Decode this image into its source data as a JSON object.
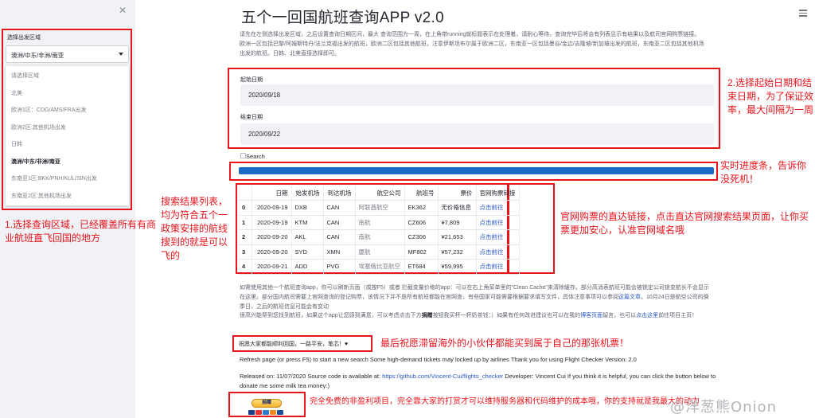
{
  "sidebar": {
    "close_icon": "close-icon",
    "select_label": "选择出发区域",
    "selected_value": "澳洲/中东/非洲/南亚",
    "options": [
      "请选择区域",
      "北美",
      "欧洲1区：CDG/AMS/FRA出发",
      "欧洲2区:其他机场出发",
      "日韩",
      "澳洲/中东/非洲/南亚",
      "东南亚1区:BKK/PNH/KUL/SIN出发",
      "东南亚2区:其他机场出发"
    ],
    "selected_index": 5
  },
  "main": {
    "title": "五个一回国航班查询APP v2.0",
    "intro": "请先在左侧选择出发区域，之后设置查询日期区间，最大 查询范围为一周，在上角带running就标题表示在处理着，请耐心等待。查询完毕后将会有列表显示有结果以及航司官网购票链接。欧洲一区包括巴黎/阿姆斯特丹/法兰克福出发的航班，欧洲二区包括其他航班，注意伊斯坦布尔属于欧洲二区，东南亚一区包括曼谷/金边/吉隆坡/新加坡出发的航班，东南亚二区包括其他机场出发的航班。日韩、北美直接选择即可。",
    "start_label": "起始日期",
    "start_date": "2020/09/18",
    "end_label": "结束日期",
    "end_date": "2020/09/22",
    "search_label": "Search",
    "progress": 1.0
  },
  "table": {
    "headers": [
      "",
      "日期",
      "始发机场",
      "到达机场",
      "航空公司",
      "航班号",
      "票价",
      "官网购票链接"
    ],
    "rows": [
      [
        "0",
        "2020-09-19",
        "DXB",
        "CAN",
        "阿联酋航空",
        "EK362",
        "无价格信息",
        "点击前往"
      ],
      [
        "1",
        "2020-09-19",
        "KTM",
        "CAN",
        "南航",
        "CZ606",
        "¥7,809",
        "点击前往"
      ],
      [
        "2",
        "2020-09-20",
        "AKL",
        "CAN",
        "南航",
        "CZ306",
        "¥21,653",
        "点击前往"
      ],
      [
        "3",
        "2020-09-20",
        "SYD",
        "XMN",
        "厦航",
        "MF802",
        "¥57,232",
        "点击前往"
      ],
      [
        "4",
        "2020-09-21",
        "ADD",
        "PVG",
        "埃塞俄比亚航空",
        "ET684",
        "¥59,995",
        "点击前往"
      ]
    ]
  },
  "body": {
    "p1a": "如需使用其他一个航班查询app，你可以刷新页面（或按F5）或者 拦截变量价格的app：可以在右上角菜单里的\"Clean Cache\"来清除缓存。部分高消表航班可能会被锁定公司锁变航长不会显示在这里。部分国内航司需要上官网查询的登记购票，该情况下并不是所有航班都能在官网查，有些国家可能需要根据要求填写文件，具体注意事项可以参阅",
    "p1_link": "这篇文章",
    "p1b": "。10月24日是航空公司的换季日，之后的航班信息可能会有变动",
    "p2a": "很高兴能帮到您找到航班，如果这个app让您感到满意，可以考虑点击下方",
    "p2_bold": "捐赠",
    "p2b": "按钮我买杯一杯奶茶钱：）如果有任何改进建议也可以在我的",
    "p2_link1": "博客页面",
    "p2c": "留言，也可以",
    "p2_link2": "点击这里",
    "p2d": "前往项目主页！",
    "wish": "祝愿大家都能顺利回国，一路平安，笔芯！♥",
    "refresh": "Refresh page (or press F5) to start a new search Some high-demand tickets may locked up by airlines Thank you for using Flight Checker Version: 2.0",
    "released_a": "Released on: 11/07/2020 Source code is available at: ",
    "released_link": "https://github.com/Vincent-Cui/flights_checker",
    "released_b": " Developer: Vincent Cui If you think it is helpful, you can click the button below to donate me some milk tea money:)",
    "donate_label": "捐赠"
  },
  "annotations": {
    "a1": "1.选择查询区域，已经覆盖所有有商业航班直飞回国的地方",
    "a2": "2.选择起始日期和结束日期，为了保证效率，最大间隔为一周",
    "a3": "实时进度条，告诉你没死机！",
    "a4": "搜索结果列表，均为符合五个一政策安排的航线搜到的就是可以飞的",
    "a5": "官网购票的直达链接，点击直达官网搜索结果页面，让你买票更加安心，认准官网域名哦",
    "a6": "最后祝愿滞留海外的小伙伴都能买到属于自己的那张机票！",
    "a7": "完全免费的非盈利项目，完全靠大家的打赏才可以维持服务器和代码维护的成本哦，你的支持就是我最大的动力"
  },
  "watermark": "@洋葱熊Onion",
  "colors": {
    "annotation": "#e8141c",
    "progress": "#1c6bc7",
    "link": "#2b58c8",
    "sidebar_bg": "#f0f2f6"
  }
}
